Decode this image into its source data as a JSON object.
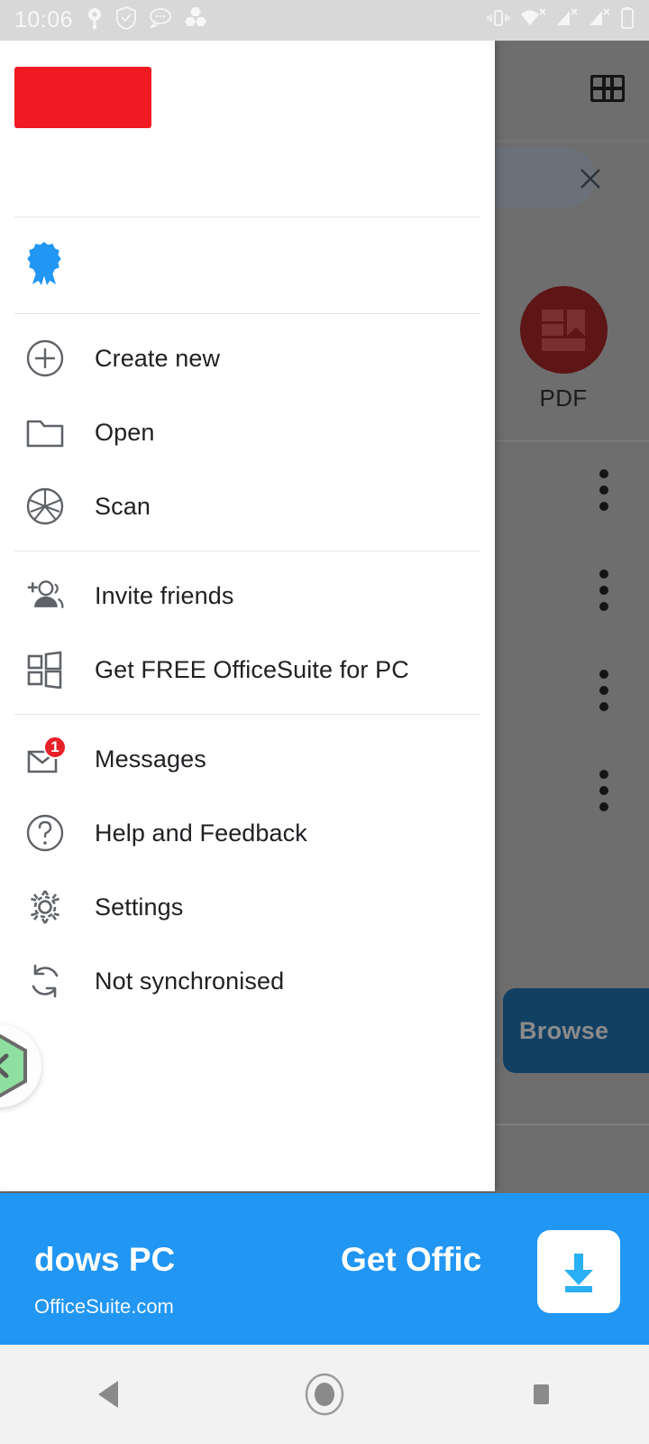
{
  "status_bar": {
    "time": "10:06",
    "left_icons": [
      "location-pin-icon",
      "shield-check-icon",
      "chat-bubbles-icon",
      "hexagon-cluster-icon"
    ],
    "right_icons": [
      "vibrate-icon",
      "wifi-no-connection-icon",
      "signal-1-no-service-icon",
      "signal-2-no-service-icon",
      "battery-icon"
    ],
    "background": "#d8d8d8"
  },
  "drawer": {
    "header": {
      "redacted_account_block": "",
      "redaction_color": "#f01b22"
    },
    "premium": {
      "icon": "ribbon-award-icon",
      "icon_color": "#2196f3",
      "label": ""
    },
    "groups": [
      {
        "items": [
          {
            "label": "Create new",
            "icon": "plus-circle-icon"
          },
          {
            "label": "Open",
            "icon": "folder-icon"
          },
          {
            "label": "Scan",
            "icon": "camera-aperture-icon"
          }
        ]
      },
      {
        "items": [
          {
            "label": "Invite friends",
            "icon": "person-add-icon"
          },
          {
            "label": "Get FREE OfficeSuite for PC",
            "icon": "windows-logo-icon"
          }
        ]
      },
      {
        "items": [
          {
            "label": "Messages",
            "icon": "mail-open-icon",
            "badge": "1",
            "badge_color": "#e8202a"
          },
          {
            "label": "Help and Feedback",
            "icon": "question-circle-icon"
          },
          {
            "label": "Settings",
            "icon": "gear-icon"
          },
          {
            "label": "Not synchronised",
            "icon": "sync-icon"
          }
        ]
      }
    ]
  },
  "floating_widget": {
    "icon": "green-hexagon-chevron-icon",
    "fill": "#8fe0a0"
  },
  "backdrop": {
    "grid_view_icon": "grid-view-icon",
    "search_close_icon": "close-icon",
    "pdf_tile": {
      "label": "PDF",
      "circle_color": "#5e1515",
      "icon": "pdf-document-icon"
    },
    "overflow_menus": [
      "overflow-menu-icon",
      "overflow-menu-icon",
      "overflow-menu-icon",
      "overflow-menu-icon"
    ],
    "browse_button": {
      "label": "Browse",
      "color": "#124063"
    },
    "scrim_color": "#6e6e6e"
  },
  "ad_banner": {
    "headline": "dows PC",
    "url": "OfficeSuite.com",
    "cta": "Get Offic",
    "download_icon": "download-icon",
    "background": "#2196f3"
  },
  "nav_bar": {
    "back": "back-triangle-icon",
    "home": "home-circle-icon",
    "recents": "recents-square-icon"
  }
}
